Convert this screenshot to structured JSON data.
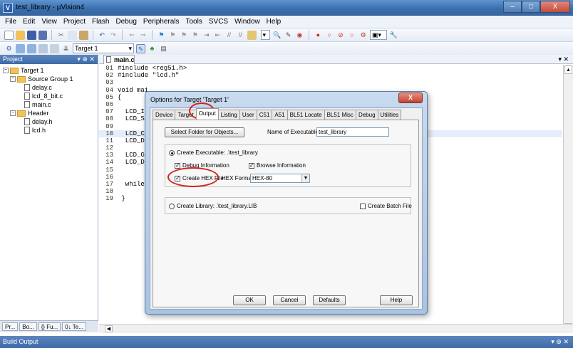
{
  "window": {
    "title": "test_library - µVision4",
    "minimize": "–",
    "maximize": "□",
    "close": "X"
  },
  "menu": [
    "File",
    "Edit",
    "View",
    "Project",
    "Flash",
    "Debug",
    "Peripherals",
    "Tools",
    "SVCS",
    "Window",
    "Help"
  ],
  "toolbar2": {
    "target_select": "Target 1"
  },
  "project_panel": {
    "title": "Project",
    "controls": "▾ ⊕ ✕",
    "tree": [
      {
        "label": "Target 1",
        "level": 0,
        "type": "folder",
        "expander": "−"
      },
      {
        "label": "Source Group 1",
        "level": 1,
        "type": "folder",
        "expander": "−"
      },
      {
        "label": "delay.c",
        "level": 2,
        "type": "file"
      },
      {
        "label": "lcd_8_bit.c",
        "level": 2,
        "type": "file"
      },
      {
        "label": "main.c",
        "level": 2,
        "type": "file"
      },
      {
        "label": "Header",
        "level": 1,
        "type": "folder",
        "expander": "−"
      },
      {
        "label": "delay.h",
        "level": 2,
        "type": "file"
      },
      {
        "label": "lcd.h",
        "level": 2,
        "type": "file"
      }
    ],
    "bottom_tabs": [
      "Pr...",
      "Bo...",
      "{} Fu...",
      "0↓ Te..."
    ]
  },
  "editor": {
    "tab": "main.c",
    "tab_close": "▾ ✕",
    "lines": [
      {
        "n": "01",
        "text": "#include <reg51.h>"
      },
      {
        "n": "02",
        "text": "#include \"lcd.h\""
      },
      {
        "n": "03",
        "text": ""
      },
      {
        "n": "04",
        "text": "void mai"
      },
      {
        "n": "05",
        "text": "{"
      },
      {
        "n": "06",
        "text": ""
      },
      {
        "n": "07",
        "text": "  LCD_I"
      },
      {
        "n": "08",
        "text": "  LCD_S"
      },
      {
        "n": "09",
        "text": ""
      },
      {
        "n": "10",
        "text": "  LCD_C"
      },
      {
        "n": "11",
        "text": "  LCD_D"
      },
      {
        "n": "12",
        "text": ""
      },
      {
        "n": "13",
        "text": "  LCD_G"
      },
      {
        "n": "14",
        "text": "  LCD_D"
      },
      {
        "n": "15",
        "text": ""
      },
      {
        "n": "16",
        "text": ""
      },
      {
        "n": "17",
        "text": "  while"
      },
      {
        "n": "18",
        "text": ""
      },
      {
        "n": "19",
        "text": " }"
      }
    ]
  },
  "build_output": {
    "title": "Build Output",
    "controls": "▾ ⊕ ✕"
  },
  "dialog": {
    "title": "Options for Target 'Target 1'",
    "close": "X",
    "tabs": [
      "Device",
      "Target",
      "Output",
      "Listing",
      "User",
      "C51",
      "A51",
      "BL51 Locate",
      "BL51 Misc",
      "Debug",
      "Utilities"
    ],
    "active_tab": "Output",
    "select_folder_button": "Select Folder for Objects...",
    "name_of_executable_label": "Name of Executable:",
    "name_of_executable_value": "test_library",
    "create_executable_label": "Create Executable:  .\\test_library",
    "debug_information_label": "Debug Information",
    "browse_information_label": "Browse Information",
    "create_hex_label": "Create HEX File",
    "hex_format_label": "HEX Format:",
    "hex_format_value": "HEX-80",
    "create_library_label": "Create Library:  .\\test_library.LIB",
    "create_batch_label": "Create Batch File",
    "buttons": {
      "ok": "OK",
      "cancel": "Cancel",
      "defaults": "Defaults",
      "help": "Help"
    }
  }
}
